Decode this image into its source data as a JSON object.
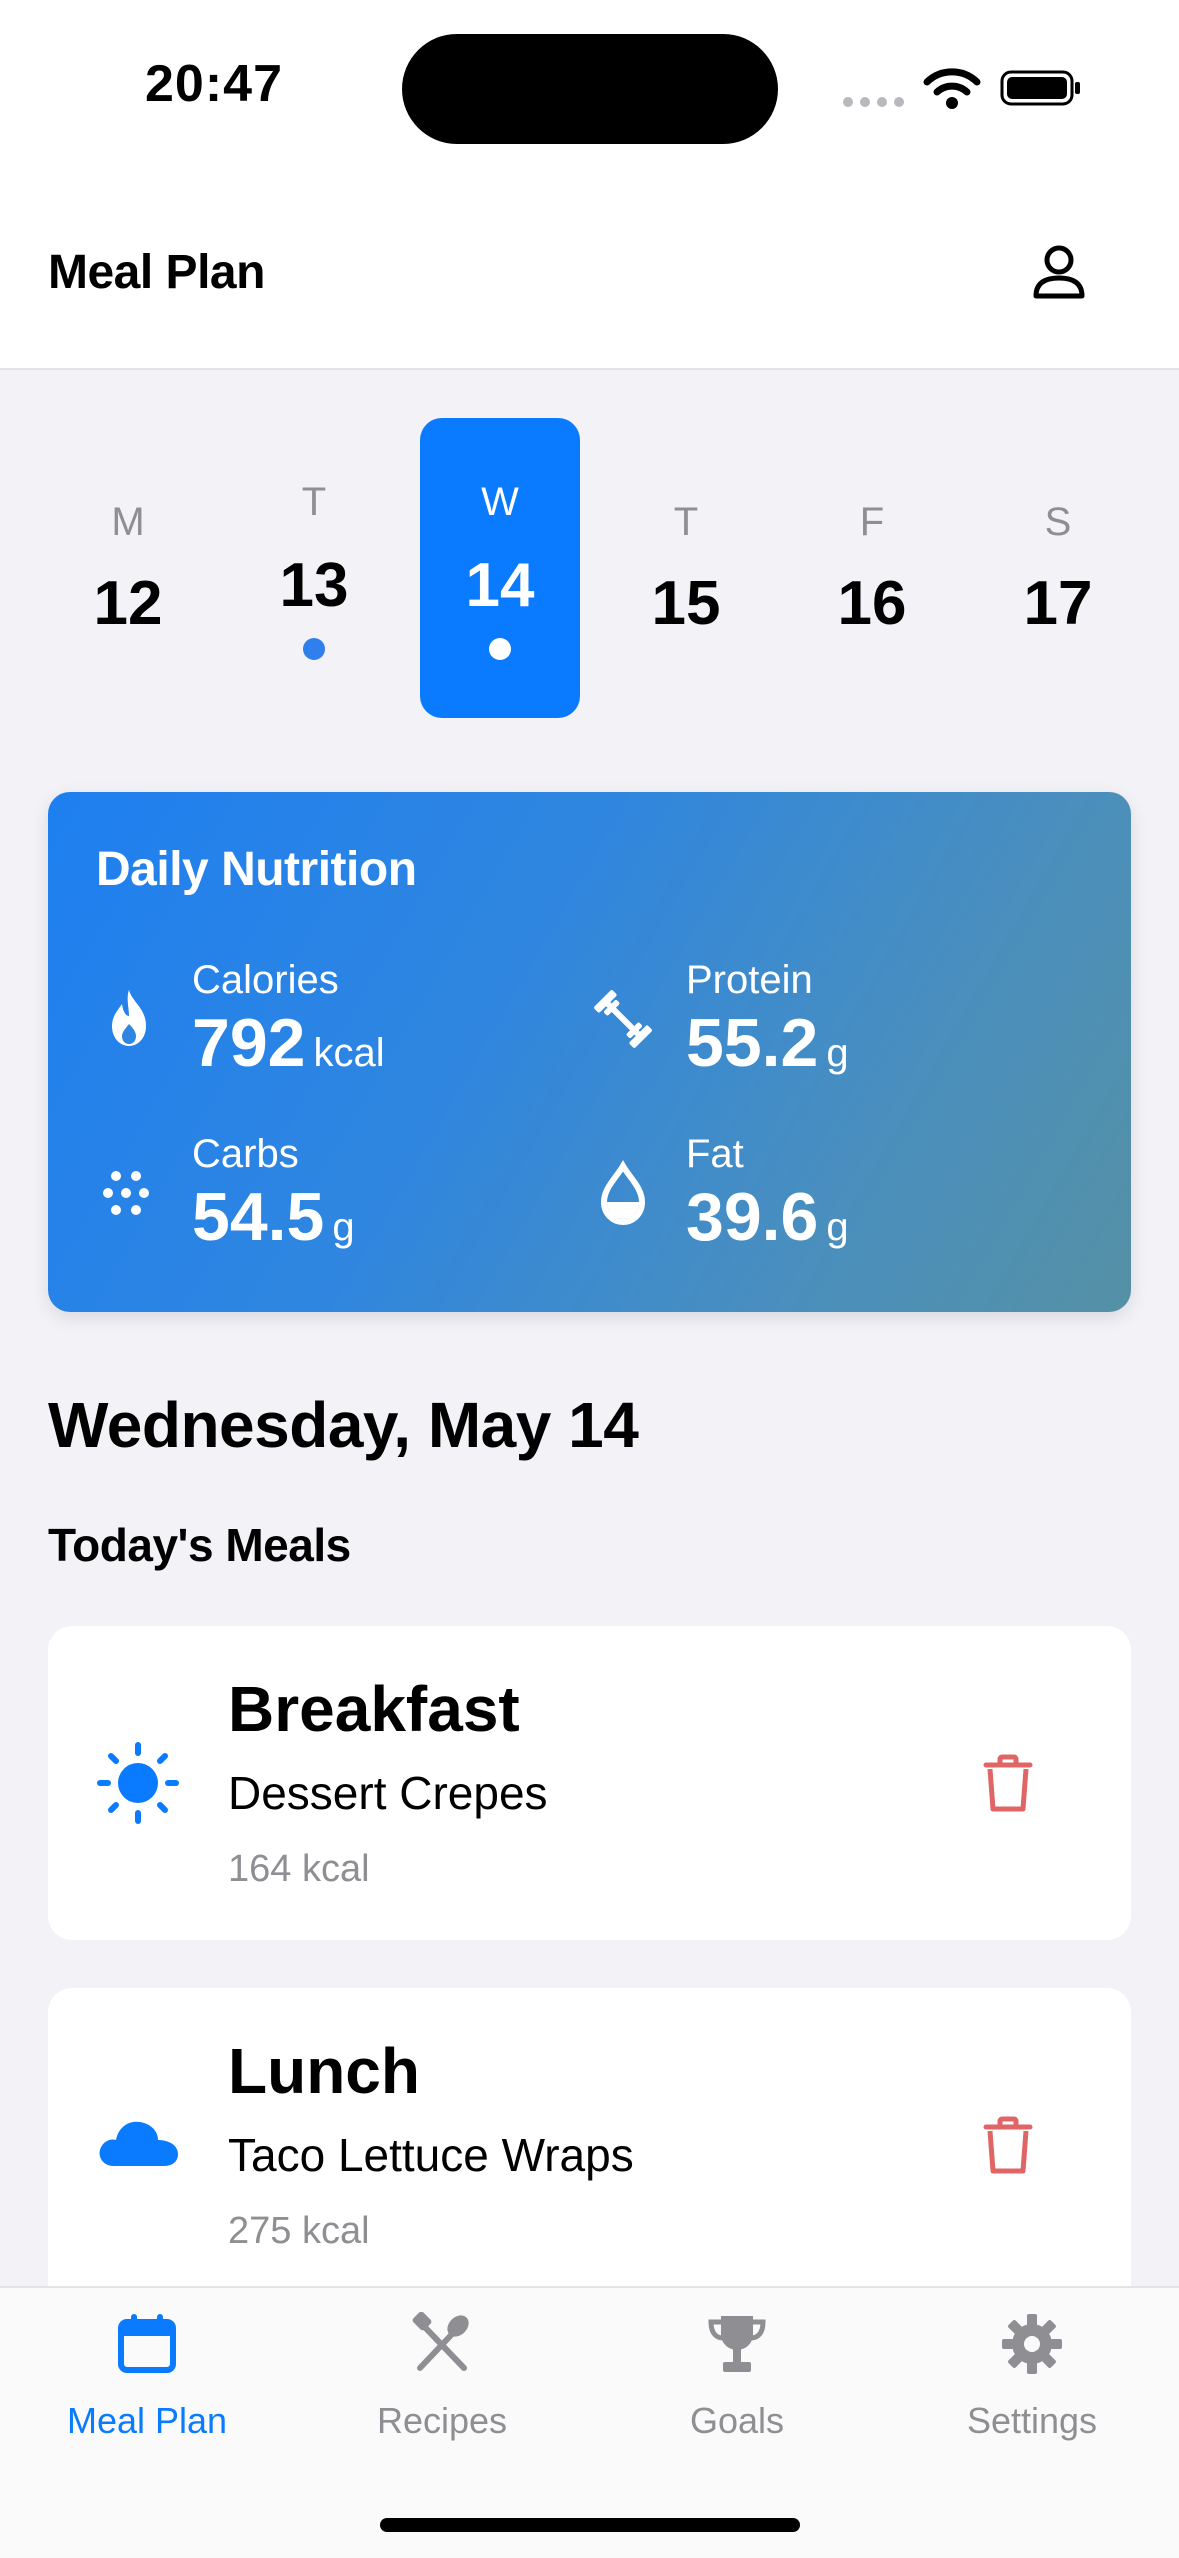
{
  "status_bar": {
    "time": "20:47"
  },
  "header": {
    "title": "Meal Plan",
    "profile_icon": "person-icon"
  },
  "week": [
    {
      "letter": "M",
      "number": "12",
      "has_meals": false,
      "selected": false
    },
    {
      "letter": "T",
      "number": "13",
      "has_meals": true,
      "selected": false
    },
    {
      "letter": "W",
      "number": "14",
      "has_meals": true,
      "selected": true
    },
    {
      "letter": "T",
      "number": "15",
      "has_meals": false,
      "selected": false
    },
    {
      "letter": "F",
      "number": "16",
      "has_meals": false,
      "selected": false
    },
    {
      "letter": "S",
      "number": "17",
      "has_meals": false,
      "selected": false
    }
  ],
  "nutrition": {
    "title": "Daily Nutrition",
    "calories": {
      "label": "Calories",
      "value": "792",
      "unit": "kcal",
      "icon": "flame-icon"
    },
    "protein": {
      "label": "Protein",
      "value": "55.2",
      "unit": "g",
      "icon": "dumbbell-icon"
    },
    "carbs": {
      "label": "Carbs",
      "value": "54.5",
      "unit": "g",
      "icon": "grains-icon"
    },
    "fat": {
      "label": "Fat",
      "value": "39.6",
      "unit": "g",
      "icon": "drop-icon"
    }
  },
  "date_heading": "Wednesday, May 14",
  "meals_heading": "Today's Meals",
  "meals": [
    {
      "name": "Breakfast",
      "recipe": "Dessert Crepes",
      "kcal": "164 kcal",
      "icon": "sun-icon"
    },
    {
      "name": "Lunch",
      "recipe": "Taco Lettuce Wraps",
      "kcal": "275 kcal",
      "icon": "cloud-icon"
    }
  ],
  "tabs": [
    {
      "label": "Meal Plan",
      "icon": "calendar-icon",
      "active": true
    },
    {
      "label": "Recipes",
      "icon": "fork-knife-icon",
      "active": false
    },
    {
      "label": "Goals",
      "icon": "trophy-icon",
      "active": false
    },
    {
      "label": "Settings",
      "icon": "gear-icon",
      "active": false
    }
  ],
  "colors": {
    "accent": "#0a7bff",
    "delete": "#e06666",
    "background": "#f2f2f7",
    "inactive_tab": "#8e8e93"
  }
}
